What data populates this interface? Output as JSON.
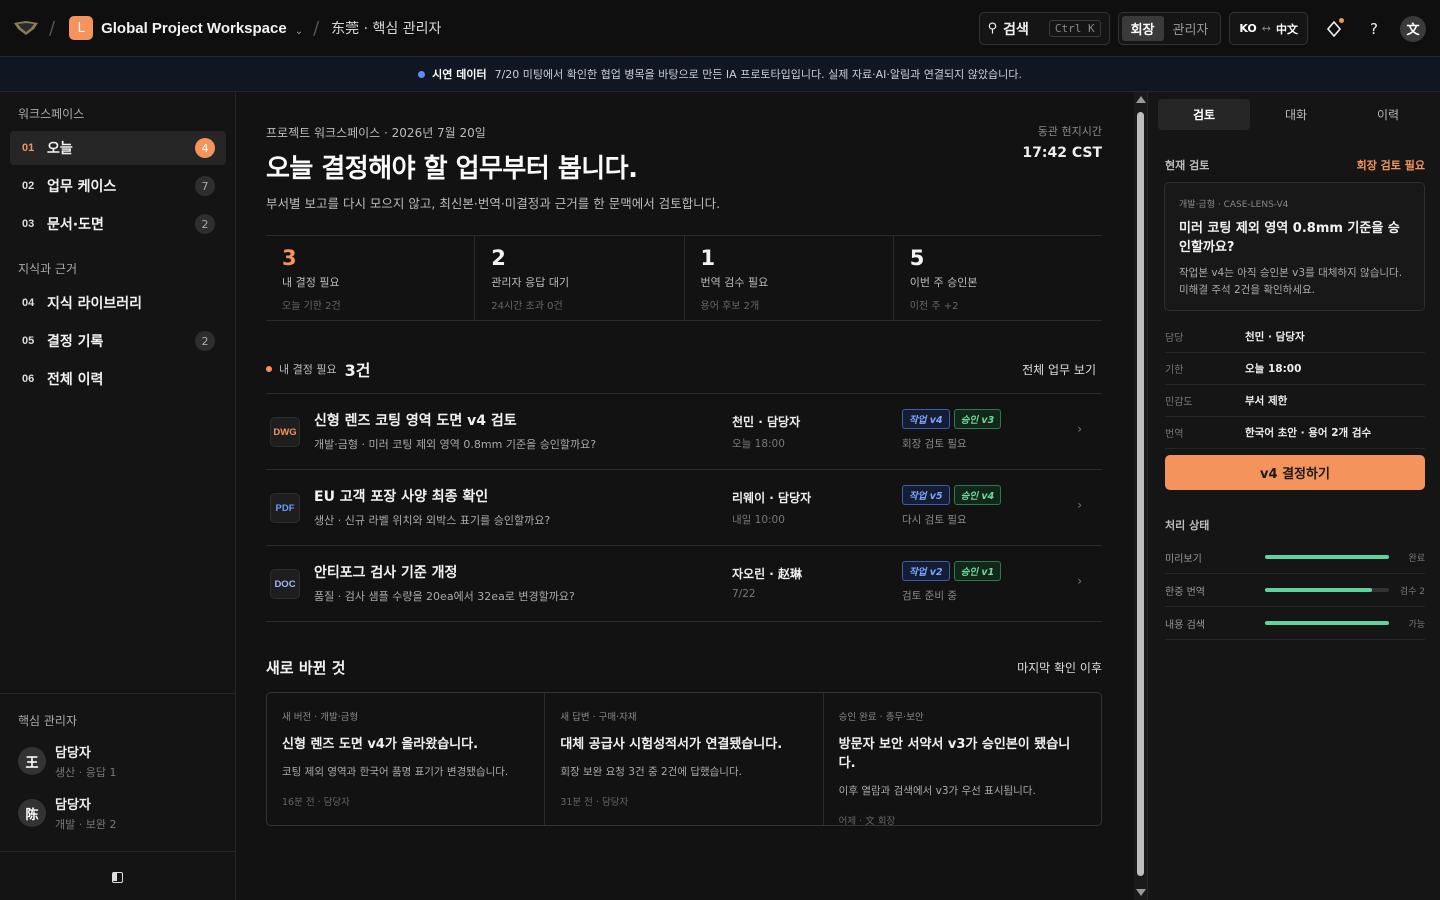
{
  "topbar": {
    "workspace_badge": "L",
    "workspace_title": "Global Project Workspace",
    "breadcrumb": "东莞 · 핵심 관리자",
    "search_label": "검색",
    "search_shortcut": "Ctrl K",
    "roles": [
      "회장",
      "관리자"
    ],
    "active_role": "회장",
    "lang_from": "KO",
    "lang_to": "中文",
    "help": "?",
    "avatar": "文"
  },
  "banner": {
    "label": "시연 데이터",
    "text": "7/20 미팅에서 확인한 협업 병목을 바탕으로 만든 IA 프로토타입입니다. 실제 자료·AI·알림과 연결되지 않았습니다."
  },
  "sidebar": {
    "section_workspace": "워크스페이스",
    "section_knowledge": "지식과 근거",
    "section_people": "핵심 관리자",
    "items": [
      {
        "num": "01",
        "label": "오늘",
        "badge": "4"
      },
      {
        "num": "02",
        "label": "업무 케이스",
        "badge": "7"
      },
      {
        "num": "03",
        "label": "문서·도면",
        "badge": "2"
      },
      {
        "num": "04",
        "label": "지식 라이브러리",
        "badge": ""
      },
      {
        "num": "05",
        "label": "결정 기록",
        "badge": "2"
      },
      {
        "num": "06",
        "label": "전체 이력",
        "badge": ""
      }
    ],
    "people": [
      {
        "avatar": "王",
        "name": "담당자",
        "meta": "생산 · 응답 1"
      },
      {
        "avatar": "陈",
        "name": "담당자",
        "meta": "개발 · 보완 2"
      }
    ]
  },
  "main": {
    "eyebrow": "프로젝트 워크스페이스 · 2026년 7월 20일",
    "title": "오늘 결정해야 할 업무부터 봅니다.",
    "subtitle": "부서별 보고를 다시 모으지 않고, 최신본·번역·미결정과 근거를 한 문맥에서 검토합니다.",
    "clock_label": "동관 현지시간",
    "clock": "17:42 CST",
    "stats": [
      {
        "value": "3",
        "label": "내 결정 필요",
        "meta": "오늘 기한 2건"
      },
      {
        "value": "2",
        "label": "관리자 응답 대기",
        "meta": "24시간 초과 0건"
      },
      {
        "value": "1",
        "label": "번역 검수 필요",
        "meta": "용어 후보 2개"
      },
      {
        "value": "5",
        "label": "이번 주 승인본",
        "meta": "이전 주 +2"
      }
    ],
    "decisions_label": "내 결정 필요",
    "decisions_count": "3건",
    "decisions_link": "전체 업무 보기",
    "decisions": [
      {
        "type": "DWG",
        "title": "신형 렌즈 코팅 영역 도면 v4 검토",
        "desc": "개발·금형 · 미러 코팅 제외 영역 0.8mm 기준을 승인할까요?",
        "owner": "천민 · 담당자",
        "due": "오늘 18:00",
        "tag_work": "작업 v4",
        "tag_ok": "승인 v3",
        "status": "회장 검토 필요"
      },
      {
        "type": "PDF",
        "title": "EU 고객 포장 사양 최종 확인",
        "desc": "생산 · 신규 라벨 위치와 외박스 표기를 승인할까요?",
        "owner": "리웨이 · 담당자",
        "due": "내일 10:00",
        "tag_work": "작업 v5",
        "tag_ok": "승인 v4",
        "status": "다시 검토 필요"
      },
      {
        "type": "DOC",
        "title": "안티포그 검사 기준 개정",
        "desc": "품질 · 검사 샘플 수량을 20ea에서 32ea로 변경할까요?",
        "owner": "자오린 · 赵琳",
        "due": "7/22",
        "tag_work": "작업 v2",
        "tag_ok": "승인 v1",
        "status": "검토 준비 중"
      }
    ],
    "changes_title": "새로 바뀐 것",
    "changes_link": "마지막 확인 이후",
    "changes": [
      {
        "kind": "새 버전 · 개발·금형",
        "title": "신형 렌즈 도면 v4가 올라왔습니다.",
        "desc": "코팅 제외 영역과 한국어 품명 표기가 변경됐습니다.",
        "meta": "16분 전 · 담당자"
      },
      {
        "kind": "새 답변 · 구매·자재",
        "title": "대체 공급사 시험성적서가 연결됐습니다.",
        "desc": "회장 보완 요청 3건 중 2건에 답했습니다.",
        "meta": "31분 전 · 담당자"
      },
      {
        "kind": "승인 완료 · 총무·보안",
        "title": "방문자 보안 서약서 v3가 승인본이 됐습니다.",
        "desc": "이후 열람과 검색에서 v3가 우선 표시됩니다.",
        "meta": "어제 · 文 회장"
      }
    ]
  },
  "panel": {
    "tabs": [
      "검토",
      "대화",
      "이력"
    ],
    "review_label": "현재 검토",
    "review_flag": "회장 검토 필요",
    "card_kind": "개발·금형 · CASE-LENS-V4",
    "card_title": "미러 코팅 제외 영역 0.8mm 기준을 승인할까요?",
    "card_desc": "작업본 v4는 아직 승인본 v3를 대체하지 않습니다. 미해결 주석 2건을 확인하세요.",
    "fields": [
      {
        "k": "담당",
        "v": "천민 · 담당자"
      },
      {
        "k": "기한",
        "v": "오늘 18:00"
      },
      {
        "k": "민감도",
        "v": "부서 제한"
      },
      {
        "k": "번역",
        "v": "한국어 초안 · 용어 2개 검수"
      }
    ],
    "cta": "v4 결정하기",
    "process_title": "처리 상태",
    "process": [
      {
        "k": "미리보기",
        "s": "완료",
        "p": 1.0
      },
      {
        "k": "한중 번역",
        "s": "검수 2",
        "p": 0.86
      },
      {
        "k": "내용 검색",
        "s": "가능",
        "p": 1.0
      }
    ]
  },
  "colors": {
    "accent": "#f4935c",
    "progress": "#5fd49a",
    "work_tag": "#7ea6ff",
    "approved_tag": "#6fdc9a"
  }
}
